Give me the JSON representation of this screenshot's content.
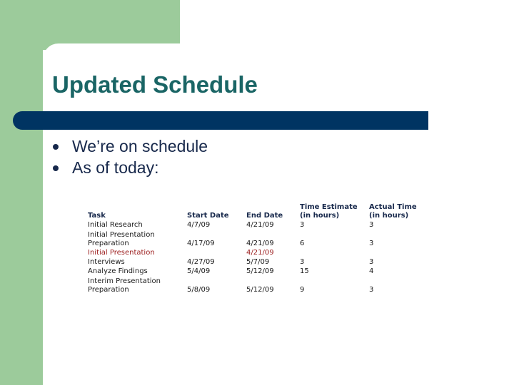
{
  "slide": {
    "title": "Updated Schedule",
    "colors": {
      "green": "#9ccb9b",
      "navy": "#003462",
      "title": "#1a6565",
      "text": "#17284b",
      "highlight_red": "#9b1c1c"
    },
    "bullets": [
      {
        "icon": "bullet-dot-icon",
        "text": "We’re on schedule"
      },
      {
        "icon": "bullet-dot-icon",
        "text": "As of today:"
      }
    ]
  },
  "table": {
    "headers": {
      "task": "Task",
      "start": "Start Date",
      "end": "End Date",
      "estimate_line1": "Time Estimate",
      "estimate_line2": "(in hours)",
      "actual_line1": "Actual Time",
      "actual_line2": "(in hours)"
    },
    "rows": [
      {
        "task1": "Initial Research",
        "task2": "",
        "start": "4/7/09",
        "end": "4/21/09",
        "estimate": "3",
        "actual": "3",
        "highlight": false
      },
      {
        "task1": "Initial Presentation",
        "task2": "Preparation",
        "start": "4/17/09",
        "end": "4/21/09",
        "estimate": "6",
        "actual": "3",
        "highlight": false
      },
      {
        "task1": "Initial Presentation",
        "task2": "",
        "start": "",
        "end": "4/21/09",
        "estimate": "",
        "actual": "",
        "highlight": true
      },
      {
        "task1": "Interviews",
        "task2": "",
        "start": "4/27/09",
        "end": "5/7/09",
        "estimate": "3",
        "actual": "3",
        "highlight": false
      },
      {
        "task1": "Analyze Findings",
        "task2": "",
        "start": "5/4/09",
        "end": "5/12/09",
        "estimate": "15",
        "actual": "4",
        "highlight": false
      },
      {
        "task1": "Interim Presentation",
        "task2": "Preparation",
        "start": "5/8/09",
        "end": "5/12/09",
        "estimate": "9",
        "actual": "3",
        "highlight": false
      }
    ]
  }
}
